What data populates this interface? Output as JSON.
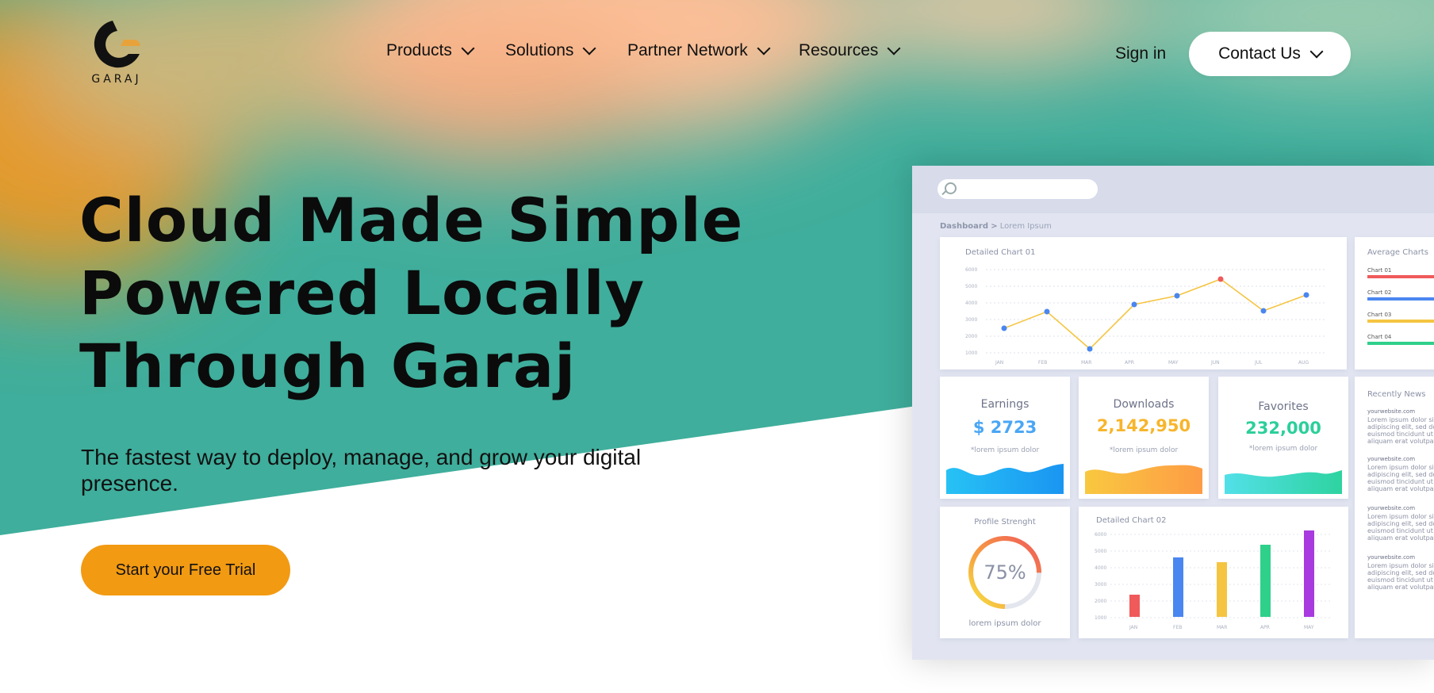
{
  "brand": {
    "name": "GARAJ",
    "accent": "#f29a12"
  },
  "nav": {
    "items": [
      {
        "label": "Products"
      },
      {
        "label": "Solutions"
      },
      {
        "label": "Partner Network"
      },
      {
        "label": "Resources"
      }
    ],
    "sign_in": "Sign in",
    "contact": "Contact Us"
  },
  "hero": {
    "title_lines": [
      "Cloud Made Simple",
      "Powered Locally",
      "Through Garaj"
    ],
    "subtitle": "The fastest way to deploy, manage, and grow your digital presence.",
    "cta": "Start your Free Trial"
  },
  "dashboard": {
    "breadcrumb_root": "Dashboard",
    "breadcrumb_sep": ">",
    "breadcrumb_leaf": "Lorem Ipsum",
    "line_chart": {
      "title": "Detailed Chart 01",
      "y_ticks": [
        "6000",
        "5000",
        "4000",
        "3000",
        "2000",
        "1000"
      ],
      "x_ticks": [
        "JAN",
        "FEB",
        "MAR",
        "APR",
        "MAY",
        "JUN",
        "JUL",
        "AUG"
      ]
    },
    "average": {
      "title": "Average Charts",
      "items": [
        {
          "label": "Chart 01",
          "color": "#f05a5a"
        },
        {
          "label": "Chart 02",
          "color": "#4a86f0"
        },
        {
          "label": "Chart 03",
          "color": "#f5c542"
        },
        {
          "label": "Chart 04",
          "color": "#2fd08a"
        }
      ]
    },
    "stats": [
      {
        "label": "Earnings",
        "value": "$ 2723",
        "note": "*lorem ipsum dolor",
        "color": "#4aa6f5"
      },
      {
        "label": "Downloads",
        "value": "2,142,950",
        "note": "*lorem ipsum dolor",
        "color": "#f7b52c"
      },
      {
        "label": "Favorites",
        "value": "232,000",
        "note": "*lorem ipsum dolor",
        "color": "#2ccf9a"
      }
    ],
    "profile": {
      "title": "Profile Strenght",
      "value": "75%",
      "fraction": 0.75,
      "caption": "lorem ipsum dolor"
    },
    "bar_chart": {
      "title": "Detailed Chart 02",
      "y_ticks": [
        "6000",
        "5000",
        "4000",
        "3000",
        "2000",
        "1000"
      ],
      "x_ticks": [
        "JAN",
        "FEB",
        "MAR",
        "APR",
        "MAY"
      ]
    },
    "news": {
      "title": "Recently News",
      "items": [
        {
          "site": "yourwebsite.com",
          "text": "Lorem ipsum dolor sit adipiscing elit, sed do euismod tincidunt ut aliquam erat volutpat."
        },
        {
          "site": "yourwebsite.com",
          "text": "Lorem ipsum dolor sit adipiscing elit, sed do euismod tincidunt ut aliquam erat volutpat."
        },
        {
          "site": "yourwebsite.com",
          "text": "Lorem ipsum dolor sit adipiscing elit, sed do euismod tincidunt ut aliquam erat volutpat."
        },
        {
          "site": "yourwebsite.com",
          "text": "Lorem ipsum dolor sit adipiscing elit, sed do euismod tincidunt ut aliquam erat volutpat."
        }
      ]
    }
  }
}
